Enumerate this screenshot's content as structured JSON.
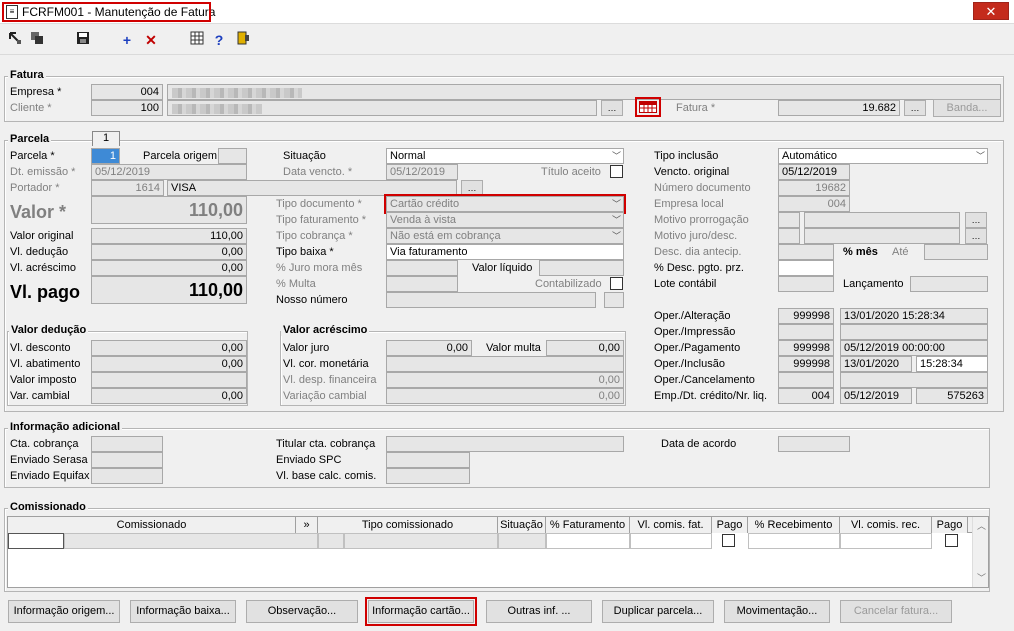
{
  "window": {
    "title": "FCRFM001 - Manutenção de Fatura",
    "close_glyph": "✕"
  },
  "toolbar": {
    "icons": [
      "first-icon",
      "copy-icon",
      "save-icon",
      "add-icon",
      "delete-icon",
      "calculator-icon",
      "help-icon",
      "exit-icon"
    ],
    "add_glyph": "+",
    "delete_glyph": "✕",
    "help_glyph": "?"
  },
  "fatura": {
    "title": "Fatura",
    "empresa_label": "Empresa *",
    "empresa_value": "004",
    "cliente_label": "Cliente *",
    "cliente_value": "100",
    "fatura_label": "Fatura *",
    "fatura_value": "19.682",
    "banda_label": "Banda..."
  },
  "parcela": {
    "title": "Parcela",
    "tab_number": "1",
    "parcela_label": "Parcela *",
    "parcela_value": "1",
    "parcela_origem_label": "Parcela origem",
    "dt_emissao_label": "Dt. emissão *",
    "dt_emissao_value": "05/12/2019",
    "portador_label": "Portador *",
    "portador_code": "1614",
    "portador_name": "VISA",
    "valor_label": "Valor *",
    "valor_value": "110,00",
    "valor_original_label": "Valor original",
    "valor_original_value": "110,00",
    "vl_deducao_label": "Vl. dedução",
    "vl_deducao_value": "0,00",
    "vl_acrescimo_label": "Vl. acréscimo",
    "vl_acrescimo_value": "0,00",
    "vl_pago_label": "Vl. pago",
    "vl_pago_value": "110,00",
    "situacao_label": "Situação",
    "situacao_value": "Normal",
    "data_vencto_label": "Data vencto. *",
    "data_vencto_value": "05/12/2019",
    "titulo_aceito_label": "Título aceito",
    "tipo_documento_label": "Tipo documento *",
    "tipo_documento_value": "Cartão crédito",
    "tipo_faturamento_label": "Tipo faturamento *",
    "tipo_faturamento_value": "Venda à vista",
    "tipo_cobranca_label": "Tipo cobrança *",
    "tipo_cobranca_value": "Não está em cobrança",
    "tipo_baixa_label": "Tipo baixa *",
    "tipo_baixa_value": "Via faturamento",
    "juro_mora_label": "% Juro mora mês",
    "valor_liquido_label": "Valor líquido",
    "multa_label": "% Multa",
    "contabilizado_label": "Contabilizado",
    "nosso_numero_label": "Nosso número",
    "tipo_inclusao_label": "Tipo inclusão",
    "tipo_inclusao_value": "Automático",
    "vencto_original_label": "Vencto. original",
    "vencto_original_value": "05/12/2019",
    "numero_documento_label": "Número documento",
    "numero_documento_value": "19682",
    "empresa_local_label": "Empresa local",
    "empresa_local_value": "004",
    "motivo_prorrogacao_label": "Motivo prorrogação",
    "motivo_juro_label": "Motivo juro/desc.",
    "desc_dia_label": "Desc. dia antecip.",
    "pct_mes_label": "% mês",
    "ate_label": "Até",
    "pct_desc_label": "% Desc. pgto. prz.",
    "lote_contabil_label": "Lote contábil",
    "lancamento_label": "Lançamento"
  },
  "oper": {
    "alteracao_label": "Oper./Alteração",
    "alteracao_user": "999998",
    "alteracao_date": "13/01/2020 15:28:34",
    "impressao_label": "Oper./Impressão",
    "pagamento_label": "Oper./Pagamento",
    "pagamento_user": "999998",
    "pagamento_date": "05/12/2019 00:00:00",
    "inclusao_label": "Oper./Inclusão",
    "inclusao_user": "999998",
    "inclusao_date": "13/01/2020",
    "inclusao_time": "15:28:34",
    "cancelamento_label": "Oper./Cancelamento",
    "emp_label": "Emp./Dt. crédito/Nr. liq.",
    "emp_value": "004",
    "emp_date": "05/12/2019",
    "emp_nr": "575263"
  },
  "valor_deducao": {
    "title": "Valor dedução",
    "vl_desconto_label": "Vl. desconto",
    "vl_desconto_value": "0,00",
    "vl_abatimento_label": "Vl. abatimento",
    "vl_abatimento_value": "0,00",
    "valor_imposto_label": "Valor imposto",
    "var_cambial_label": "Var. cambial",
    "var_cambial_value": "0,00"
  },
  "valor_acrescimo": {
    "title": "Valor acréscimo",
    "valor_juro_label": "Valor juro",
    "valor_juro_value": "0,00",
    "valor_multa_label": "Valor multa",
    "valor_multa_value": "0,00",
    "vl_cor_label": "Vl. cor. monetária",
    "vl_desp_label": "Vl. desp. financeira",
    "vl_desp_value": "0,00",
    "variacao_label": "Variação cambial",
    "variacao_value": "0,00"
  },
  "info_adicional": {
    "title": "Informação adicional",
    "cta_cobranca_label": "Cta. cobrança",
    "enviado_serasa_label": "Enviado Serasa",
    "enviado_equifax_label": "Enviado Equifax",
    "titular_label": "Titular cta. cobrança",
    "enviado_spc_label": "Enviado SPC",
    "vl_base_label": "Vl. base calc. comis.",
    "data_acordo_label": "Data de acordo"
  },
  "comissionado": {
    "title": "Comissionado",
    "columns": [
      "Comissionado",
      "»",
      "Tipo comissionado",
      "Situação",
      "% Faturamento",
      "Vl. comis. fat.",
      "Pago",
      "% Recebimento",
      "Vl. comis. rec.",
      "Pago"
    ]
  },
  "footer": {
    "informacao_origem": "Informação origem...",
    "informacao_baixa": "Informação baixa...",
    "observacao": "Observação...",
    "informacao_cartao": "Informação cartão...",
    "outras_inf": "Outras inf. ...",
    "duplicar_parcela": "Duplicar parcela...",
    "movimentacao": "Movimentação...",
    "cancelar_fatura": "Cancelar fatura..."
  },
  "colors": {
    "highlight": "#d00000",
    "close": "#c42b1c"
  }
}
